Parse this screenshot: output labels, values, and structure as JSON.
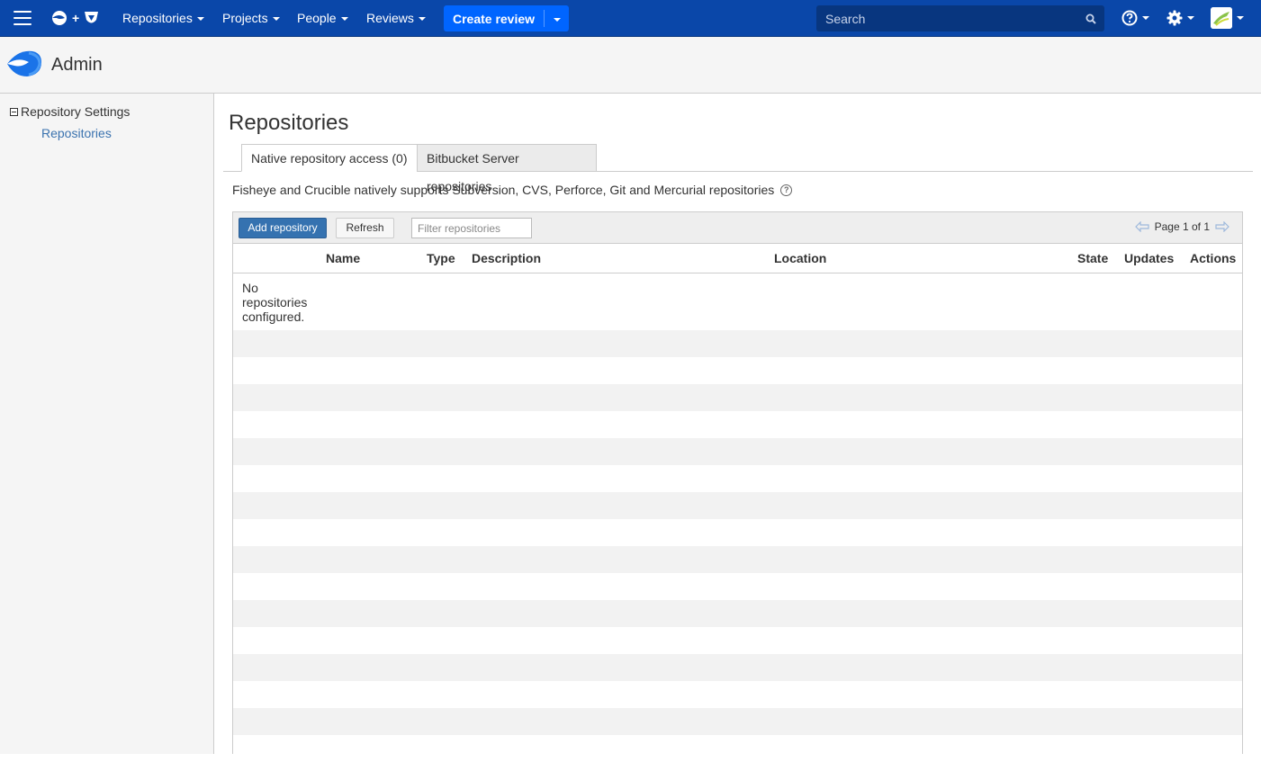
{
  "nav": {
    "menu_icon": "hamburger-menu-icon",
    "items": [
      {
        "label": "Repositories"
      },
      {
        "label": "Projects"
      },
      {
        "label": "People"
      },
      {
        "label": "Reviews"
      }
    ],
    "create_review_label": "Create review",
    "search_placeholder": "Search"
  },
  "header": {
    "title": "Admin"
  },
  "sidebar": {
    "section_label": "Repository Settings",
    "link_label": "Repositories"
  },
  "main": {
    "title": "Repositories",
    "tabs": [
      {
        "label": "Native repository access (0)",
        "active": true
      },
      {
        "label": "Bitbucket Server repositories",
        "active": false
      }
    ],
    "description": "Fisheye and Crucible natively supports Subversion, CVS, Perforce, Git and Mercurial repositories",
    "toolbar": {
      "add_label": "Add repository",
      "refresh_label": "Refresh",
      "filter_placeholder": "Filter repositories",
      "page_label": "Page 1 of 1"
    },
    "columns": [
      "Name",
      "Type",
      "Description",
      "Location",
      "State",
      "Updates",
      "Actions"
    ],
    "empty_message": "No repositories configured."
  },
  "colors": {
    "nav_bg": "#0a47a9",
    "create_btn": "#0065ff",
    "link": "#3b73af",
    "add_btn": "#3572b0"
  }
}
